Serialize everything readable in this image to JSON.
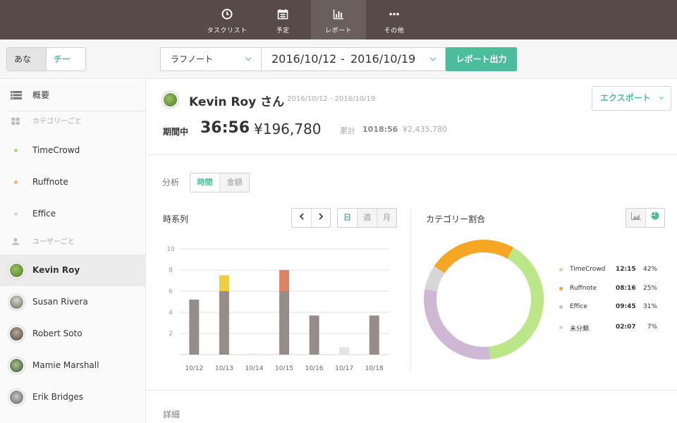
{
  "nav": {
    "items": [
      {
        "label": "タスクリスト",
        "icon": "clock-icon"
      },
      {
        "label": "予定",
        "icon": "calendar-icon"
      },
      {
        "label": "レポート",
        "icon": "bar-chart-icon"
      },
      {
        "label": "その他",
        "icon": "more-dots-icon"
      }
    ],
    "active": "レポート"
  },
  "toolbar": {
    "scope_you": "あなた",
    "scope_team": "チーム",
    "project": "ラフノート",
    "date_from": "2016/10/12",
    "date_sep": "-",
    "date_to": "2016/10/19",
    "report_button": "レポート出力"
  },
  "sidebar": {
    "overview": "概要",
    "by_category": "カテゴリーごと",
    "categories": [
      {
        "label": "TimeCrowd",
        "color": "#a8dd7c"
      },
      {
        "label": "Ruffnote",
        "color": "#f5b763"
      },
      {
        "label": "Effice",
        "color": "#d8d8d8"
      }
    ],
    "by_user": "ユーザーごと",
    "users": [
      {
        "label": "Kevin Roy"
      },
      {
        "label": "Susan Rivera"
      },
      {
        "label": "Robert Soto"
      },
      {
        "label": "Mamie Marshall"
      },
      {
        "label": "Erik Bridges"
      }
    ]
  },
  "header": {
    "name": "Kevin Roy さん",
    "range": "2016/10/12 - 2016/10/19",
    "export": "エクスポート",
    "period_label": "期間中",
    "period_time": "36:56",
    "period_amount": "¥196,780",
    "total_label": "累計",
    "total_time": "1018:56",
    "total_amount": "¥2,435,780"
  },
  "analysis": {
    "label": "分析",
    "modes": [
      "時間",
      "金額"
    ],
    "active_mode": "時間",
    "timeseries_title": "時系列",
    "granularity": [
      "日",
      "週",
      "月"
    ],
    "active_granularity": "日",
    "category_title": "カテゴリー割合",
    "detail_label": "詳細"
  },
  "chart_data": [
    {
      "type": "bar",
      "title": "時系列",
      "categories": [
        "10/12",
        "10/13",
        "10/14",
        "10/15",
        "10/16",
        "10/17",
        "10/18"
      ],
      "ylim": [
        0,
        10
      ],
      "yticks": [
        2,
        4,
        6,
        8,
        10
      ],
      "grid": true,
      "series": [
        {
          "values": [
            5.2,
            6.0,
            0.1,
            6.0,
            3.7,
            0.7,
            3.7
          ],
          "colors": [
            "#968c89",
            "#968c89",
            "#e4e4e4",
            "#968c89",
            "#968c89",
            "#e4e4e4",
            "#968c89"
          ]
        },
        {
          "values": [
            0,
            1.5,
            0,
            2.0,
            0,
            0,
            0
          ],
          "colors": [
            "#968c89",
            "#f0cc3f",
            "#968c89",
            "#e08266",
            "#968c89",
            "#968c89",
            "#968c89"
          ]
        }
      ]
    },
    {
      "type": "pie",
      "title": "カテゴリー割合",
      "slices": [
        {
          "label": "TimeCrowd",
          "time": "12:15",
          "percent": 42,
          "color": "#bbe789"
        },
        {
          "label": "Effice",
          "time": "09:45",
          "percent": 31,
          "color": "#cfb8d3"
        },
        {
          "label": "未分類",
          "time": "02:07",
          "percent": 7,
          "color": "#d7d7d7"
        },
        {
          "label": "Ruffnote",
          "time": "08:16",
          "percent": 25,
          "color": "#f5a623"
        }
      ],
      "legend_order": [
        "TimeCrowd",
        "Ruffnote",
        "Effice",
        "未分類"
      ]
    }
  ]
}
